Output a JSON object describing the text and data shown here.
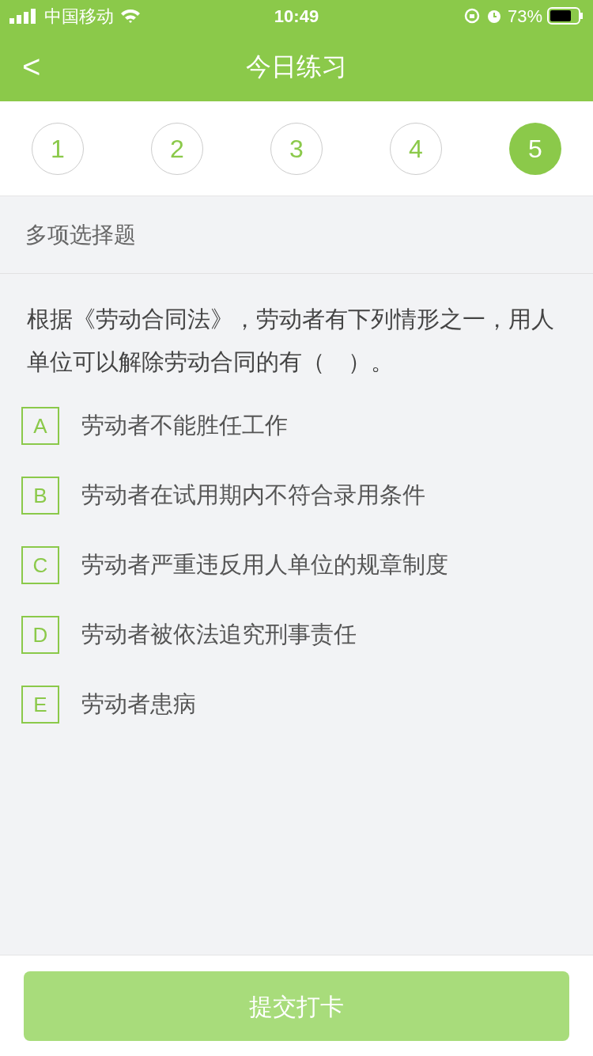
{
  "status_bar": {
    "carrier": "中国移动",
    "time": "10:49",
    "battery": "73%"
  },
  "header": {
    "back": "<",
    "title": "今日练习"
  },
  "steps": [
    {
      "label": "1",
      "selected": false
    },
    {
      "label": "2",
      "selected": false
    },
    {
      "label": "3",
      "selected": false
    },
    {
      "label": "4",
      "selected": false
    },
    {
      "label": "5",
      "selected": true
    }
  ],
  "question_type": "多项选择题",
  "question": "根据《劳动合同法》，劳动者有下列情形之一，用人单位可以解除劳动合同的有（　）。",
  "options": [
    {
      "letter": "A",
      "text": "劳动者不能胜任工作",
      "selected": false
    },
    {
      "letter": "B",
      "text": "劳动者在试用期内不符合录用条件",
      "selected": false
    },
    {
      "letter": "C",
      "text": "劳动者严重违反用人单位的规章制度",
      "selected": false
    },
    {
      "letter": "D",
      "text": "劳动者被依法追究刑事责任",
      "selected": false
    },
    {
      "letter": "E",
      "text": "劳动者患病",
      "selected": false
    }
  ],
  "submit": {
    "label": "提交打卡",
    "disabled": true
  }
}
